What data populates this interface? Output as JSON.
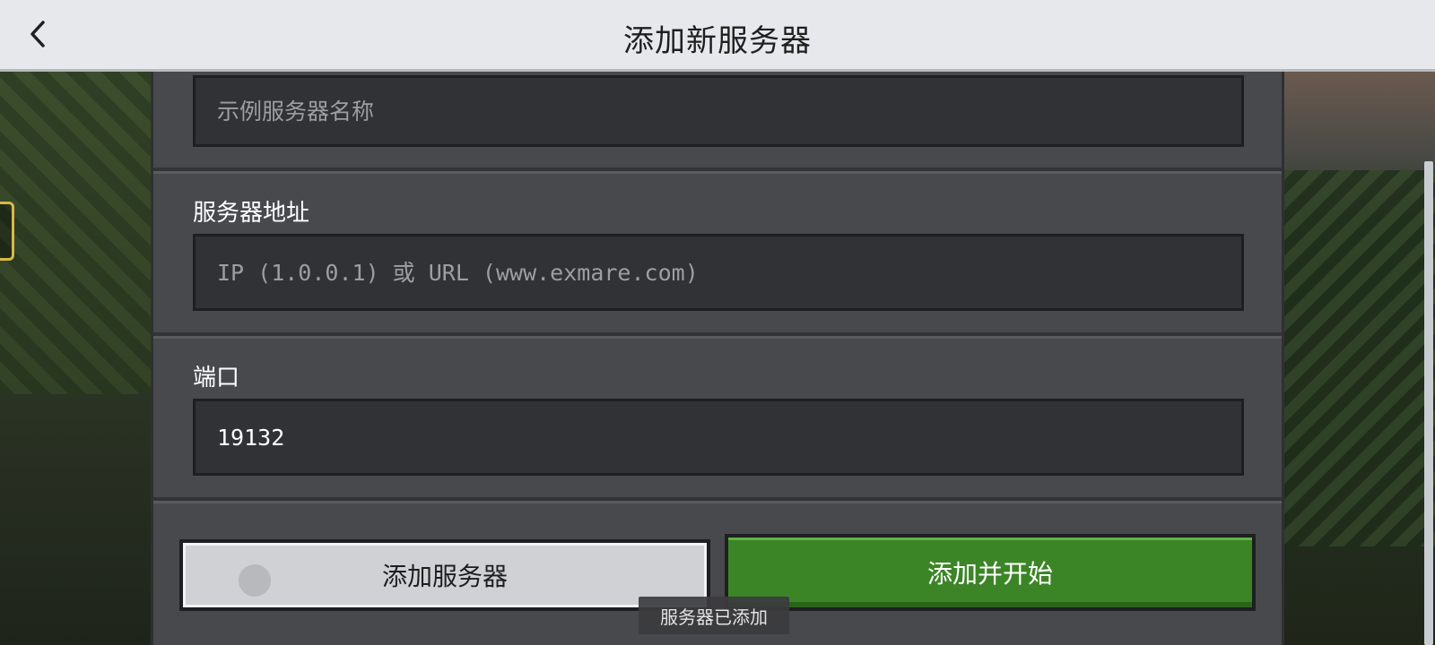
{
  "header": {
    "title": "添加新服务器",
    "back_icon": "chevron-left-icon"
  },
  "form": {
    "server_name": {
      "placeholder": "示例服务器名称",
      "value": ""
    },
    "server_address": {
      "label": "服务器地址",
      "placeholder": "IP (1.0.0.1) 或 URL (www.exmare.com)",
      "value": ""
    },
    "port": {
      "label": "端口",
      "value": "19132"
    }
  },
  "actions": {
    "add_server_label": "添加服务器",
    "add_and_start_label": "添加并开始"
  },
  "toast": {
    "message": "服务器已添加"
  },
  "colors": {
    "header_bg": "#e6e8eb",
    "panel_bg": "#48494d",
    "input_bg": "#313235",
    "primary_green": "#3c8527",
    "secondary_button": "#d0d1d4"
  }
}
